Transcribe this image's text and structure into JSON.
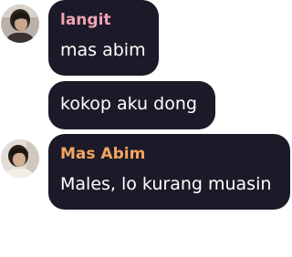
{
  "messages": [
    {
      "sender": "langit",
      "sender_color": "#f0a3b6",
      "text": "mas abim",
      "avatar_icon": "user-avatar-photo"
    },
    {
      "sender": "",
      "text": "kokop aku dong"
    },
    {
      "sender": "Mas Abim",
      "sender_color": "#f4a55f",
      "text": "Males, lo kurang muasin",
      "avatar_icon": "user-avatar-photo"
    }
  ],
  "theme": {
    "bubble_bg": "#1c1a28",
    "message_text_color": "#ffffff"
  }
}
